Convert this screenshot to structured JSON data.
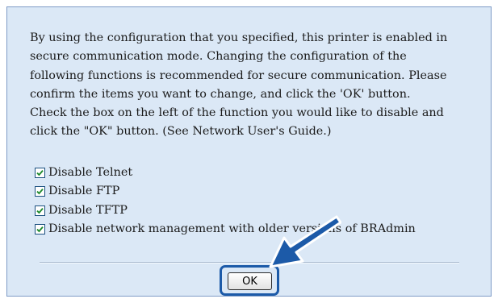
{
  "dialog": {
    "message": "By using the configuration that you specified, this printer is enabled in\nsecure communication mode. Changing the configuration of the\nfollowing functions is recommended for secure communication. Please\nconfirm the items you want to change, and click the 'OK' button.\nCheck the box on the left of the function you would like to disable and\nclick the \"OK\" button. (See Network User's Guide.)",
    "options": [
      {
        "label": "Disable Telnet",
        "checked": true
      },
      {
        "label": "Disable FTP",
        "checked": true
      },
      {
        "label": "Disable TFTP",
        "checked": true
      },
      {
        "label": "Disable network management with older versions of BRAdmin",
        "checked": true
      }
    ],
    "ok_label": "OK"
  },
  "annotation": {
    "arrow_icon": "arrow-pointing-to-ok-button",
    "highlight_color": "#1c5aa8"
  },
  "colors": {
    "dialog_background": "#dbe8f6",
    "checkbox_border": "#1c5180",
    "check_color": "#1f8a2e"
  }
}
